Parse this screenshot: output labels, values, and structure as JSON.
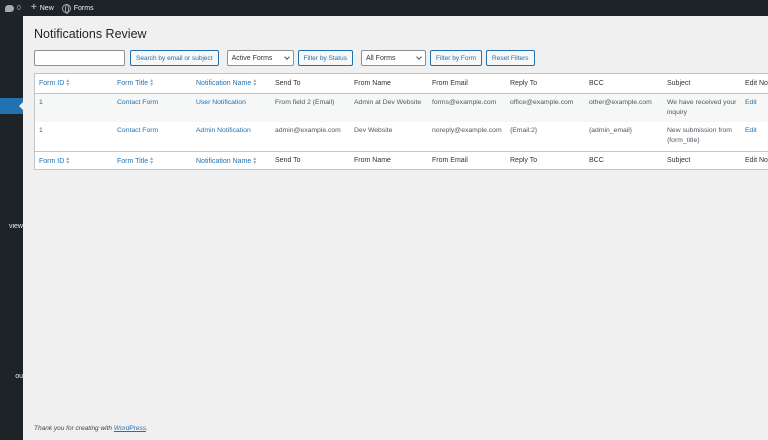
{
  "adminbar": {
    "comments_count": "0",
    "new_label": "New",
    "forms_label": "Forms"
  },
  "sidebar": {
    "labels": [
      {
        "text": "view"
      },
      {
        "text": "ou"
      }
    ]
  },
  "page": {
    "title": "Notifications Review"
  },
  "filters": {
    "search_placeholder": "",
    "search_value": "",
    "search_button": "Search by email or subject",
    "status_select": "Active Forms",
    "status_button": "Filter by Status",
    "form_select": "All Forms",
    "form_button": "Filter by Form",
    "reset_button": "Reset Filters"
  },
  "table": {
    "columns": [
      {
        "label": "Form ID",
        "sortable": true
      },
      {
        "label": "Form Title",
        "sortable": true
      },
      {
        "label": "Notification Name",
        "sortable": true
      },
      {
        "label": "Send To",
        "sortable": false
      },
      {
        "label": "From Name",
        "sortable": false
      },
      {
        "label": "From Email",
        "sortable": false
      },
      {
        "label": "Reply To",
        "sortable": false
      },
      {
        "label": "BCC",
        "sortable": false
      },
      {
        "label": "Subject",
        "sortable": false
      },
      {
        "label": "Edit Notification",
        "sortable": false
      }
    ],
    "rows": [
      {
        "form_id": "1",
        "form_title": "Contact Form",
        "notification_name": "User Notification",
        "send_to": "From field 2 (Email)",
        "from_name": "Admin at Dev Website",
        "from_email": "forms@example.com",
        "reply_to": "office@example.com",
        "bcc": "other@example.com",
        "subject": "We have received your inquiry",
        "edit": "Edit"
      },
      {
        "form_id": "1",
        "form_title": "Contact Form",
        "notification_name": "Admin Notification",
        "send_to": "admin@example.com",
        "from_name": "Dev Website",
        "from_email": "noreply@example.com",
        "reply_to": "{Email:2}",
        "bcc": "{admin_email}",
        "subject": "New submission from {form_title}",
        "edit": "Edit"
      }
    ]
  },
  "footer": {
    "text_prefix": "Thank you for creating with ",
    "link_text": "WordPress",
    "text_suffix": "."
  }
}
